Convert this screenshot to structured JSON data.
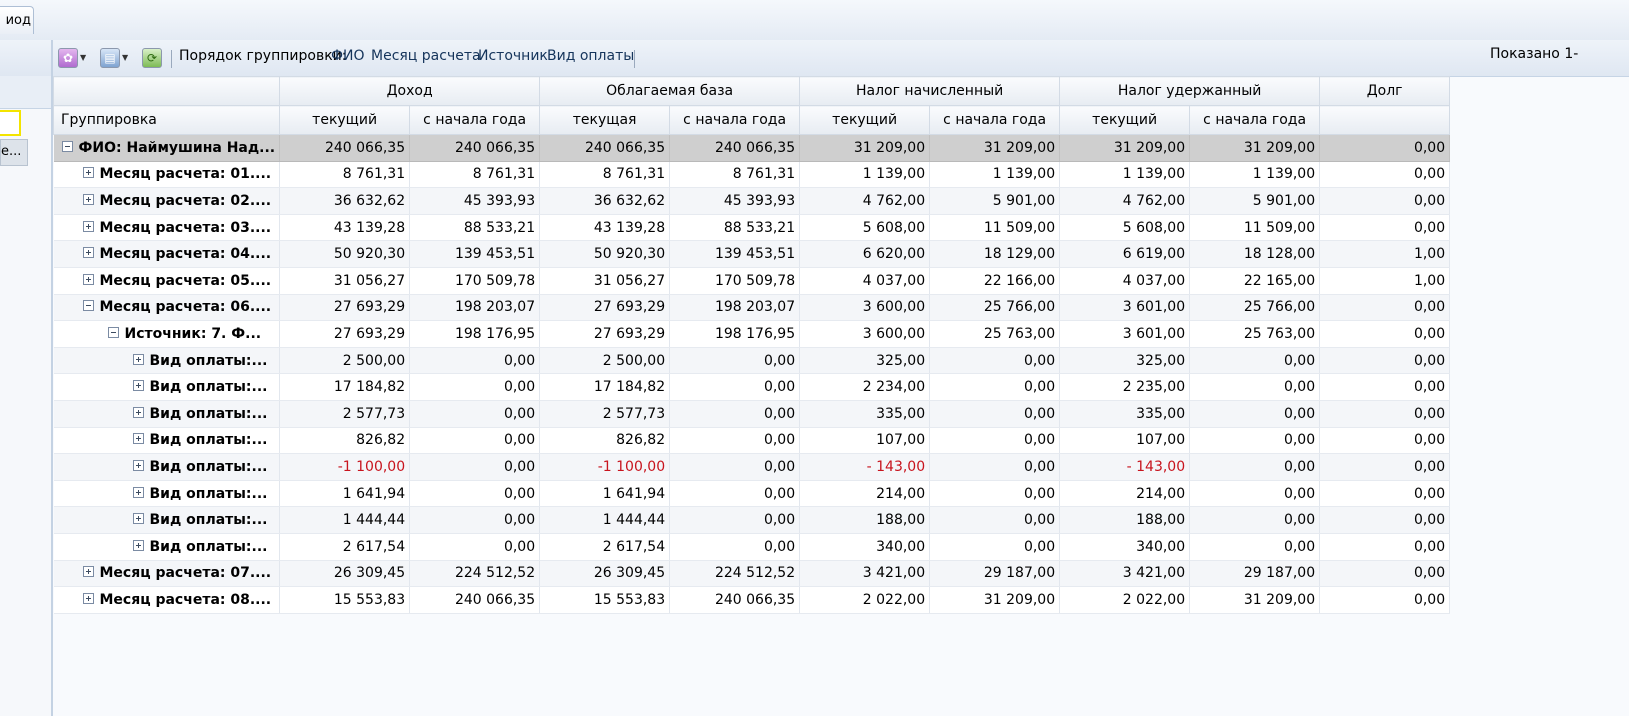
{
  "top_tab": {
    "label": "иод"
  },
  "left_pane": {
    "selected_text": "е..."
  },
  "toolbar": {
    "add_icon": "add-menu-icon",
    "print_icon": "printer-icon",
    "refresh_icon": "refresh-icon",
    "grouping_label": "Порядок группировки:",
    "grouping_items": [
      "ФИО",
      "Месяц расчета",
      "Источник",
      "Вид оплаты"
    ],
    "shown_text": "Показано 1-"
  },
  "header_groups": [
    {
      "label": ""
    },
    {
      "label": "Доход"
    },
    {
      "label": "Облагаемая база"
    },
    {
      "label": "Налог начисленный"
    },
    {
      "label": "Налог удержанный"
    },
    {
      "label": "Долг"
    }
  ],
  "columns": [
    "Группировка",
    "текущий",
    "с начала года",
    "текущая",
    "с начала года",
    "текущий",
    "с начала года",
    "текущий",
    "с начала года",
    ""
  ],
  "rows": [
    {
      "level": 0,
      "expanded": true,
      "label": "ФИО: Наймушина Над...",
      "values": [
        "240 066,35",
        "240 066,35",
        "240 066,35",
        "240 066,35",
        "31 209,00",
        "31 209,00",
        "31 209,00",
        "31 209,00",
        "0,00"
      ]
    },
    {
      "level": 1,
      "expanded": false,
      "label": "Месяц расчета: 01....",
      "values": [
        "8 761,31",
        "8 761,31",
        "8 761,31",
        "8 761,31",
        "1 139,00",
        "1 139,00",
        "1 139,00",
        "1 139,00",
        "0,00"
      ]
    },
    {
      "level": 1,
      "expanded": false,
      "label": "Месяц расчета: 02....",
      "values": [
        "36 632,62",
        "45 393,93",
        "36 632,62",
        "45 393,93",
        "4 762,00",
        "5 901,00",
        "4 762,00",
        "5 901,00",
        "0,00"
      ]
    },
    {
      "level": 1,
      "expanded": false,
      "label": "Месяц расчета: 03....",
      "values": [
        "43 139,28",
        "88 533,21",
        "43 139,28",
        "88 533,21",
        "5 608,00",
        "11 509,00",
        "5 608,00",
        "11 509,00",
        "0,00"
      ]
    },
    {
      "level": 1,
      "expanded": false,
      "label": "Месяц расчета: 04....",
      "values": [
        "50 920,30",
        "139 453,51",
        "50 920,30",
        "139 453,51",
        "6 620,00",
        "18 129,00",
        "6 619,00",
        "18 128,00",
        "1,00"
      ]
    },
    {
      "level": 1,
      "expanded": false,
      "label": "Месяц расчета: 05....",
      "values": [
        "31 056,27",
        "170 509,78",
        "31 056,27",
        "170 509,78",
        "4 037,00",
        "22 166,00",
        "4 037,00",
        "22 165,00",
        "1,00"
      ]
    },
    {
      "level": 1,
      "expanded": true,
      "label": "Месяц расчета: 06....",
      "values": [
        "27 693,29",
        "198 203,07",
        "27 693,29",
        "198 203,07",
        "3 600,00",
        "25 766,00",
        "3 601,00",
        "25 766,00",
        "0,00"
      ]
    },
    {
      "level": 2,
      "expanded": true,
      "label": "Источник: 7. Ф...",
      "values": [
        "27 693,29",
        "198 176,95",
        "27 693,29",
        "198 176,95",
        "3 600,00",
        "25 763,00",
        "3 601,00",
        "25 763,00",
        "0,00"
      ]
    },
    {
      "level": 3,
      "expanded": false,
      "label": "Вид оплаты:...",
      "values": [
        "2 500,00",
        "0,00",
        "2 500,00",
        "0,00",
        "325,00",
        "0,00",
        "325,00",
        "0,00",
        "0,00"
      ]
    },
    {
      "level": 3,
      "expanded": false,
      "label": "Вид оплаты:...",
      "values": [
        "17 184,82",
        "0,00",
        "17 184,82",
        "0,00",
        "2 234,00",
        "0,00",
        "2 235,00",
        "0,00",
        "0,00"
      ]
    },
    {
      "level": 3,
      "expanded": false,
      "label": "Вид оплаты:...",
      "values": [
        "2 577,73",
        "0,00",
        "2 577,73",
        "0,00",
        "335,00",
        "0,00",
        "335,00",
        "0,00",
        "0,00"
      ]
    },
    {
      "level": 3,
      "expanded": false,
      "label": "Вид оплаты:...",
      "values": [
        "826,82",
        "0,00",
        "826,82",
        "0,00",
        "107,00",
        "0,00",
        "107,00",
        "0,00",
        "0,00"
      ]
    },
    {
      "level": 3,
      "expanded": false,
      "label": "Вид оплаты:...",
      "values": [
        "-1 100,00",
        "0,00",
        "-1 100,00",
        "0,00",
        "- 143,00",
        "0,00",
        "- 143,00",
        "0,00",
        "0,00"
      ]
    },
    {
      "level": 3,
      "expanded": false,
      "label": "Вид оплаты:...",
      "values": [
        "1 641,94",
        "0,00",
        "1 641,94",
        "0,00",
        "214,00",
        "0,00",
        "214,00",
        "0,00",
        "0,00"
      ]
    },
    {
      "level": 3,
      "expanded": false,
      "label": "Вид оплаты:...",
      "values": [
        "1 444,44",
        "0,00",
        "1 444,44",
        "0,00",
        "188,00",
        "0,00",
        "188,00",
        "0,00",
        "0,00"
      ]
    },
    {
      "level": 3,
      "expanded": false,
      "label": "Вид оплаты:...",
      "values": [
        "2 617,54",
        "0,00",
        "2 617,54",
        "0,00",
        "340,00",
        "0,00",
        "340,00",
        "0,00",
        "0,00"
      ]
    },
    {
      "level": 1,
      "expanded": false,
      "label": "Месяц расчета: 07....",
      "values": [
        "26 309,45",
        "224 512,52",
        "26 309,45",
        "224 512,52",
        "3 421,00",
        "29 187,00",
        "3 421,00",
        "29 187,00",
        "0,00"
      ]
    },
    {
      "level": 1,
      "expanded": false,
      "label": "Месяц расчета: 08....",
      "values": [
        "15 553,83",
        "240 066,35",
        "15 553,83",
        "240 066,35",
        "2 022,00",
        "31 209,00",
        "2 022,00",
        "31 209,00",
        "0,00"
      ]
    }
  ],
  "colors": {
    "negative": "#c8141e",
    "selected_row": "#cfcfcf"
  }
}
